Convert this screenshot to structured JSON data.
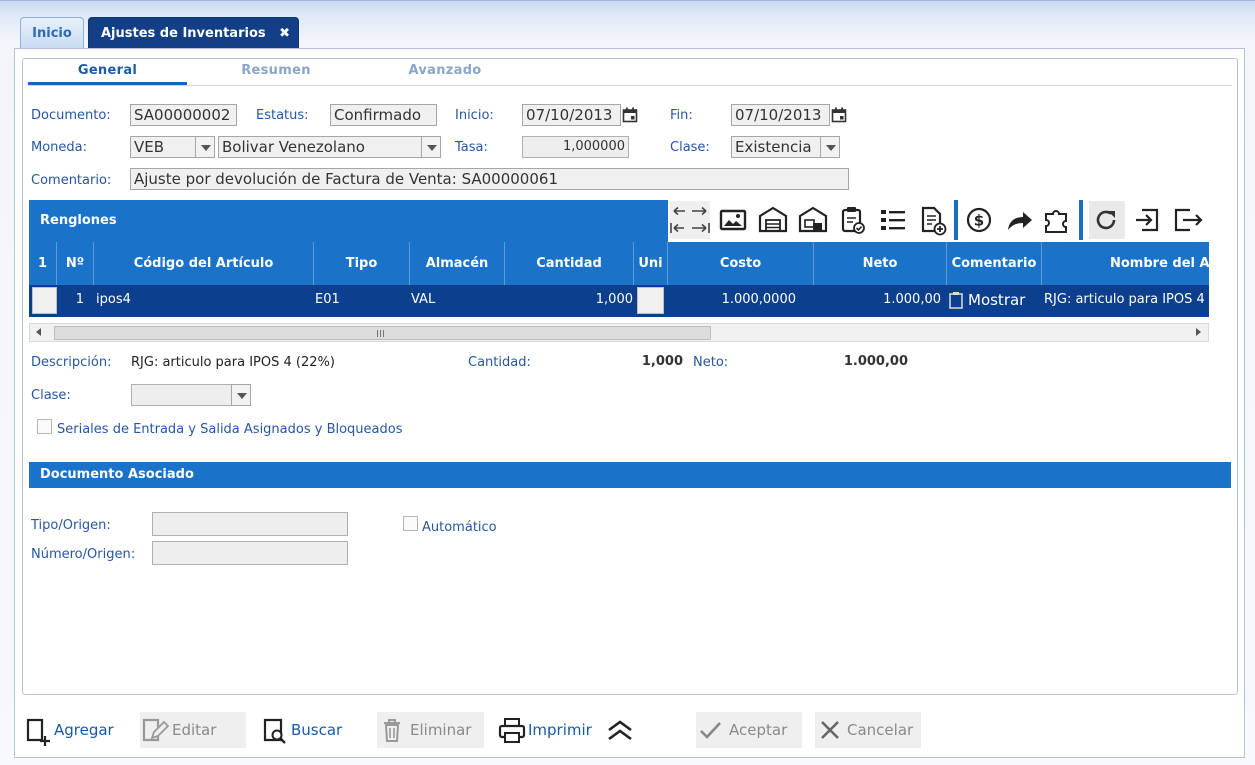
{
  "tabs": {
    "inicio": "Inicio",
    "ajustes": "Ajustes de Inventarios",
    "close_glyph": "✖"
  },
  "subtabs": {
    "general": "General",
    "resumen": "Resumen",
    "avanzado": "Avanzado"
  },
  "form": {
    "documento_label": "Documento:",
    "documento_value": "SA00000002",
    "estatus_label": "Estatus:",
    "estatus_value": "Confirmado",
    "inicio_label": "Inicio:",
    "inicio_value": "07/10/2013",
    "fin_label": "Fin:",
    "fin_value": "07/10/2013",
    "moneda_label": "Moneda:",
    "moneda_code": "VEB",
    "moneda_name": "Bolivar Venezolano",
    "tasa_label": "Tasa:",
    "tasa_value": "1,000000",
    "clase_label": "Clase:",
    "clase_value": "Existencia",
    "comentario_label": "Comentario:",
    "comentario_value": "Ajuste por devolución de Factura de Venta: SA00000061"
  },
  "renglones": {
    "title": "Renglones",
    "columns": [
      "1",
      "Nº",
      "Código del Artículo",
      "Tipo",
      "Almacén",
      "Cantidad",
      "Uni",
      "Costo",
      "Neto",
      "Comentario",
      "Nombre del A"
    ],
    "row": {
      "numero": "1",
      "codigo": "ipos4",
      "tipo": "E01",
      "almacen": "VAL",
      "cantidad": "1,000",
      "costo": "1.000,0000",
      "neto": "1.000,00",
      "comentario": "Mostrar",
      "nombre": "RJG: articulo para IPOS 4"
    }
  },
  "toolbar_icons": [
    "expand-collapse-icon",
    "image-icon",
    "warehouse-icon",
    "warehouse-move-icon",
    "clipboard-check-icon",
    "list-icon",
    "document-add-icon",
    "dollar-icon",
    "forward-arrow-icon",
    "puzzle-icon",
    "refresh-icon",
    "import-icon",
    "export-icon"
  ],
  "detail": {
    "descripcion_label": "Descripción:",
    "descripcion_value": "RJG: articulo para IPOS 4 (22%)",
    "cantidad_label": "Cantidad:",
    "cantidad_value": "1,000",
    "neto_label": "Neto:",
    "neto_value": "1.000,00",
    "clase_label": "Clase:",
    "seriales_label": "Seriales de Entrada y Salida Asignados y Bloqueados"
  },
  "asociado": {
    "title": "Documento Asociado",
    "tipo_label": "Tipo/Origen:",
    "numero_label": "Número/Origen:",
    "automatico_label": "Automático"
  },
  "actions": {
    "agregar": "Agregar",
    "editar": "Editar",
    "buscar": "Buscar",
    "eliminar": "Eliminar",
    "imprimir": "Imprimir",
    "aceptar": "Aceptar",
    "cancelar": "Cancelar"
  },
  "colors": {
    "header_blue": "#1a73c9",
    "selected_row": "#0c3f8e",
    "active_tab": "#123f85",
    "label_blue": "#2656a3"
  }
}
